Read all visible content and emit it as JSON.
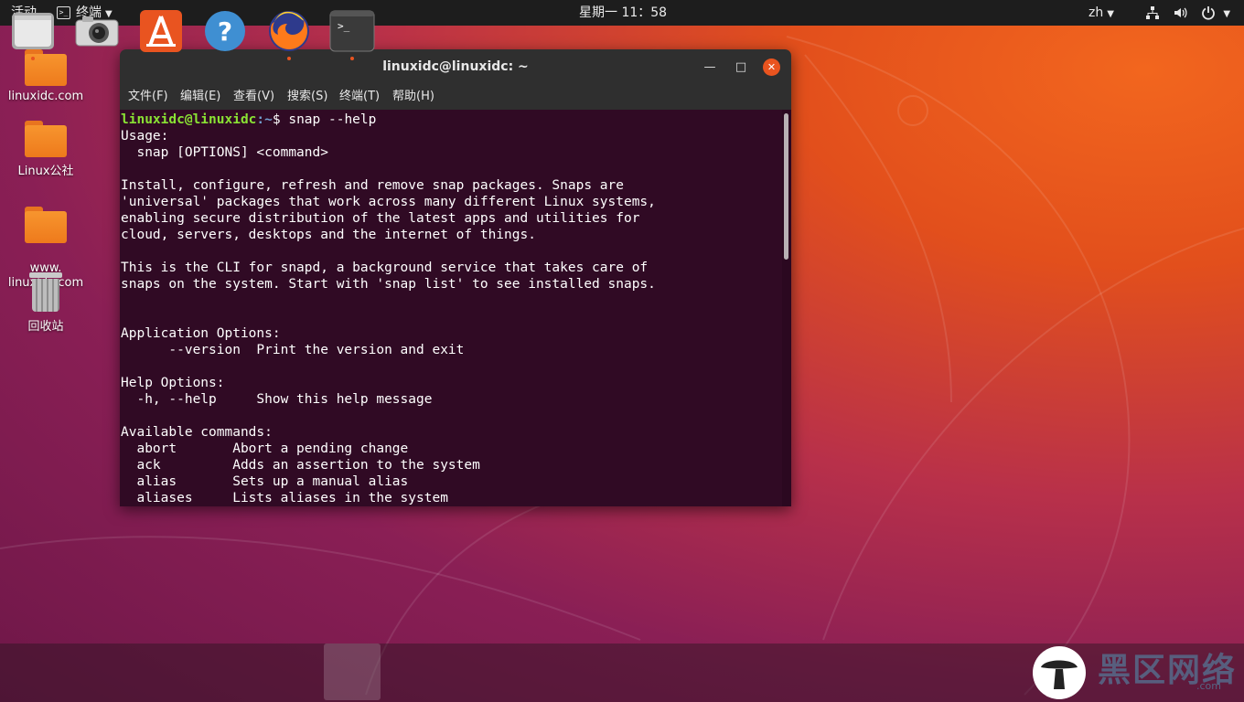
{
  "topbar": {
    "activities": "活动",
    "app_menu": "终端",
    "clock": "星期一 11：58",
    "lang": "zh"
  },
  "desktop_icons": [
    {
      "label": "linuxidc.com"
    },
    {
      "label": "Linux公社"
    },
    {
      "label": "www.\nlinuxidc.com"
    },
    {
      "label": "回收站"
    }
  ],
  "window": {
    "title": "linuxidc@linuxidc: ~",
    "menu": [
      "文件(F)",
      "编辑(E)",
      "查看(V)",
      "搜索(S)",
      "终端(T)",
      "帮助(H)"
    ]
  },
  "terminal": {
    "prompt_user": "linuxidc@linuxidc",
    "prompt_path": ":~",
    "prompt_cmd": "$ snap --help",
    "output": "Usage:\n  snap [OPTIONS] <command>\n\nInstall, configure, refresh and remove snap packages. Snaps are\n'universal' packages that work across many different Linux systems,\nenabling secure distribution of the latest apps and utilities for\ncloud, servers, desktops and the internet of things.\n\nThis is the CLI for snapd, a background service that takes care of\nsnaps on the system. Start with 'snap list' to see installed snaps.\n\n\nApplication Options:\n      --version  Print the version and exit\n\nHelp Options:\n  -h, --help     Show this help message\n\nAvailable commands:\n  abort       Abort a pending change\n  ack         Adds an assertion to the system\n  alias       Sets up a manual alias\n  aliases     Lists aliases in the system"
  },
  "dock": [
    {
      "icon": "files-icon"
    },
    {
      "icon": "camera-icon"
    },
    {
      "icon": "software-center-icon"
    },
    {
      "icon": "help-icon"
    },
    {
      "icon": "firefox-icon"
    },
    {
      "icon": "terminal-icon",
      "glyph": ">_"
    }
  ],
  "watermark": {
    "text": "黑区网络",
    "sub": ".com"
  },
  "colors": {
    "accent": "#e95420",
    "terminal_bg": "#300a24",
    "prompt_user": "#8ae234",
    "prompt_path": "#729fcf"
  }
}
